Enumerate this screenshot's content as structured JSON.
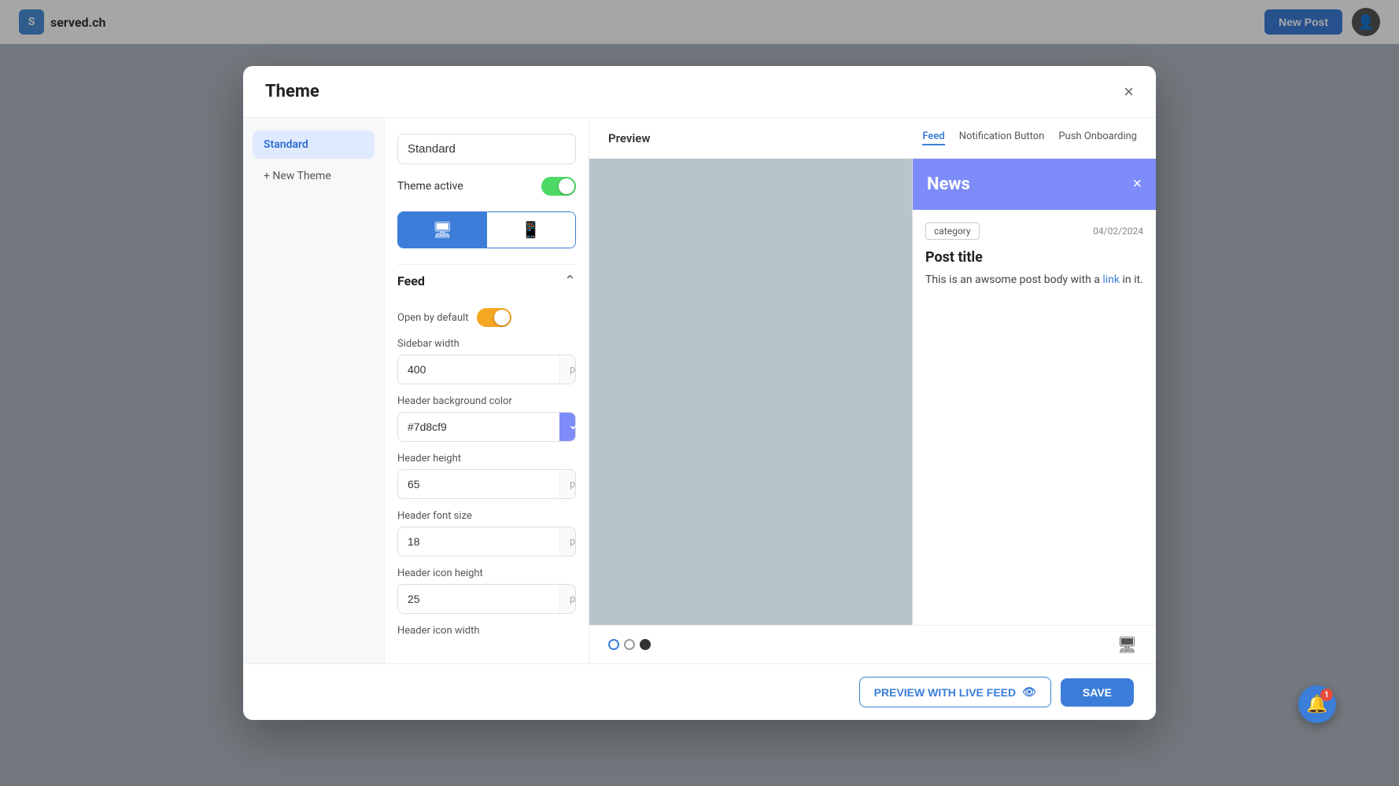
{
  "app": {
    "logo_text": "served.ch",
    "logo_icon": "S"
  },
  "topbar": {
    "new_post_label": "New Post",
    "avatar_icon": "👤"
  },
  "modal": {
    "title": "Theme",
    "close_icon": "×"
  },
  "sidebar": {
    "active_item": "Standard",
    "new_theme_label": "+ New Theme"
  },
  "settings": {
    "theme_name": "Standard",
    "theme_active_label": "Theme active",
    "theme_active": true,
    "device_desktop_icon": "🖥",
    "device_mobile_icon": "📱"
  },
  "feed_section": {
    "title": "Feed",
    "open_default_label": "Open by default",
    "sidebar_width_label": "Sidebar width",
    "sidebar_width_value": "400",
    "sidebar_width_unit": "px",
    "header_bg_color_label": "Header background color",
    "header_bg_color_value": "#7d8cf9",
    "header_height_label": "Header height",
    "header_height_value": "65",
    "header_height_unit": "px",
    "header_font_size_label": "Header font size",
    "header_font_size_value": "18",
    "header_font_size_unit": "px",
    "header_icon_height_label": "Header icon height",
    "header_icon_height_value": "25",
    "header_icon_height_unit": "px",
    "header_icon_width_label": "Header icon width"
  },
  "preview": {
    "title": "Preview",
    "tabs": [
      {
        "label": "Feed",
        "active": true
      },
      {
        "label": "Notification Button",
        "active": false
      },
      {
        "label": "Push Onboarding",
        "active": false
      }
    ]
  },
  "news_panel": {
    "title": "News",
    "close_icon": "×",
    "category": "category",
    "date": "04/02/2024",
    "post_title": "Post title",
    "post_body_start": "This is an awsome post body with a ",
    "post_link_text": "link",
    "post_body_end": " in it."
  },
  "preview_footer": {
    "dots": [
      "outline",
      "gray",
      "dark"
    ],
    "desktop_icon": "🖥"
  },
  "footer": {
    "preview_live_label": "PREVIEW WITH LIVE FEED",
    "preview_live_icon": "👁",
    "save_label": "SAVE"
  },
  "notification": {
    "badge_count": "1"
  }
}
